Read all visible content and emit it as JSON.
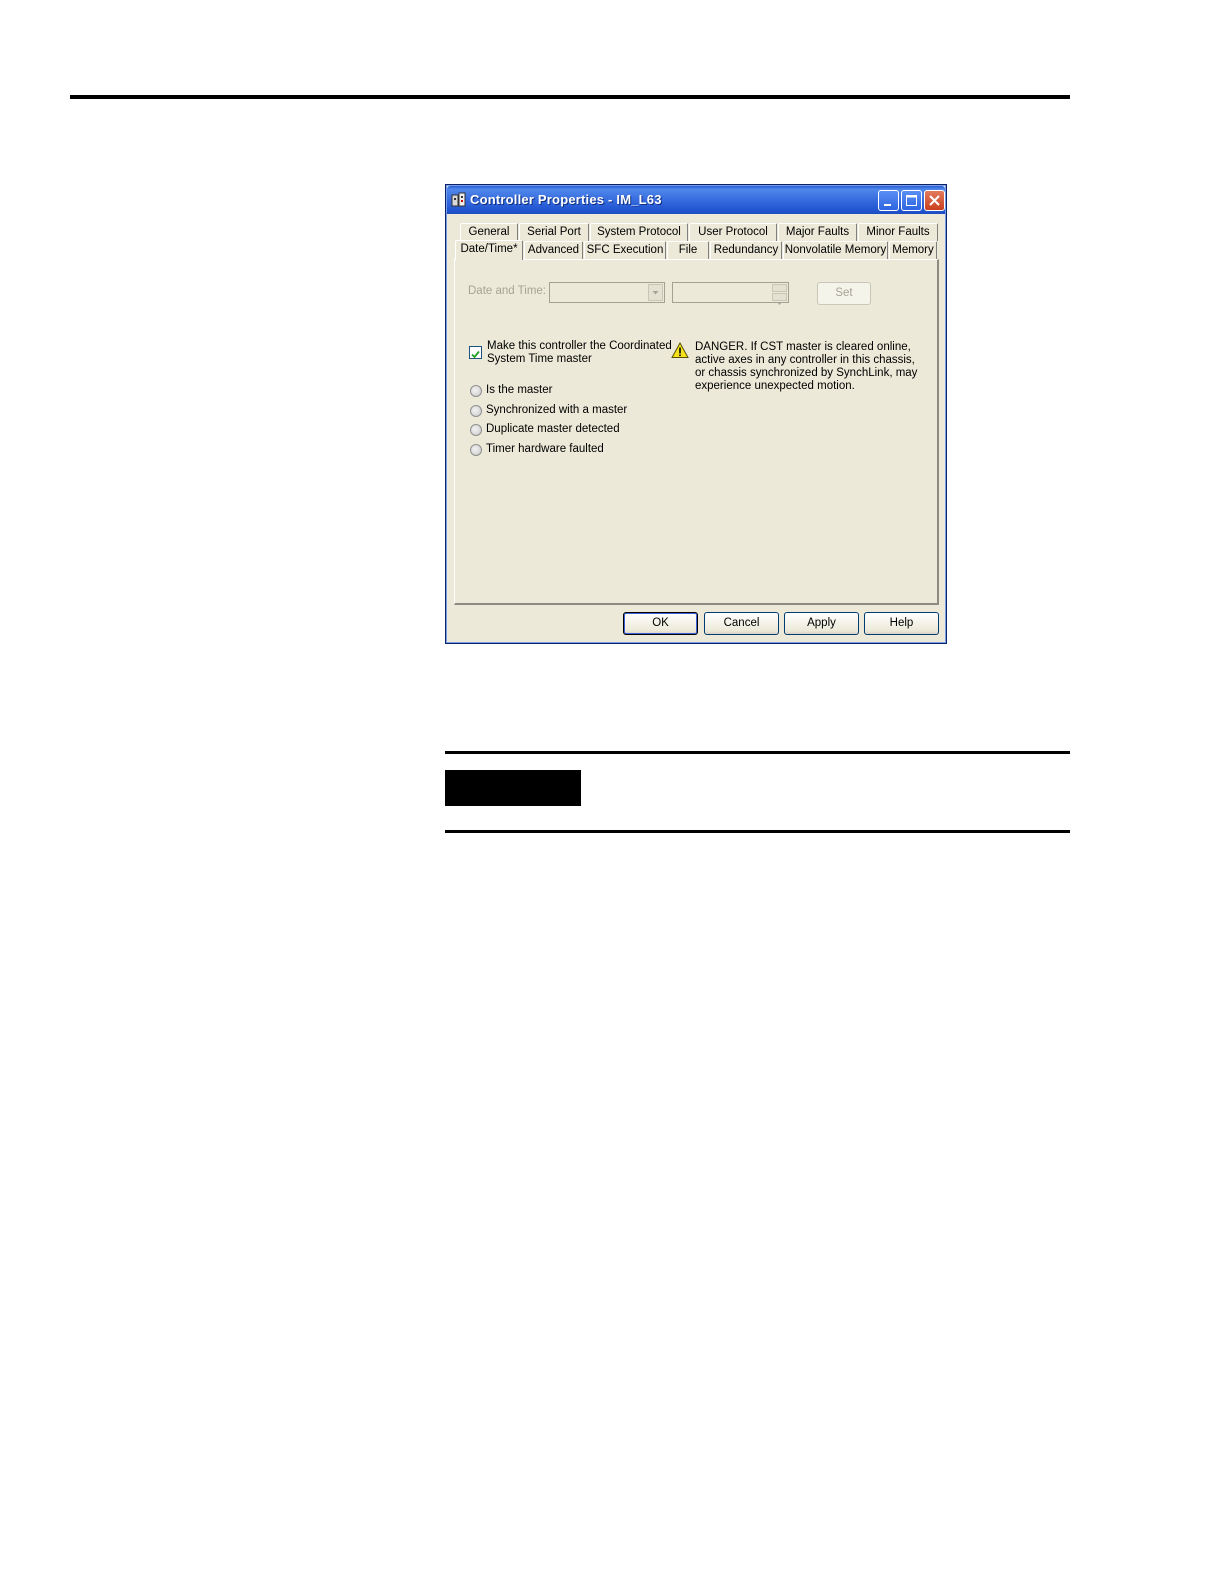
{
  "window": {
    "title": "Controller Properties - IM_L63",
    "app_icon": "controller-app-icon",
    "controls": [
      "minimize-icon",
      "maximize-icon",
      "close-icon"
    ]
  },
  "tabs_row1": [
    "General",
    "Serial Port",
    "System Protocol",
    "User Protocol",
    "Major Faults",
    "Minor Faults"
  ],
  "tabs_row2": [
    "Date/Time*",
    "Advanced",
    "SFC Execution",
    "File",
    "Redundancy",
    "Nonvolatile Memory",
    "Memory"
  ],
  "active_tab": "Date/Time*",
  "date_time": {
    "label": "Date and Time:",
    "date_value": "",
    "time_value": "",
    "set_button": "Set"
  },
  "cst_master": {
    "checkbox_label_line1": "Make this controller the Coordinated",
    "checkbox_label_line2": "System Time master",
    "checked": true
  },
  "status_options": [
    "Is the master",
    "Synchronized with a master",
    "Duplicate master detected",
    "Timer hardware faulted"
  ],
  "warning": {
    "icon": "warning-icon",
    "line1": "DANGER. If CST master is cleared online,",
    "line2": "active axes in any controller in this chassis,",
    "line3": "or chassis synchronized by SynchLink, may",
    "line4": "experience unexpected motion."
  },
  "buttons": {
    "ok": "OK",
    "cancel": "Cancel",
    "apply": "Apply",
    "help": "Help"
  }
}
